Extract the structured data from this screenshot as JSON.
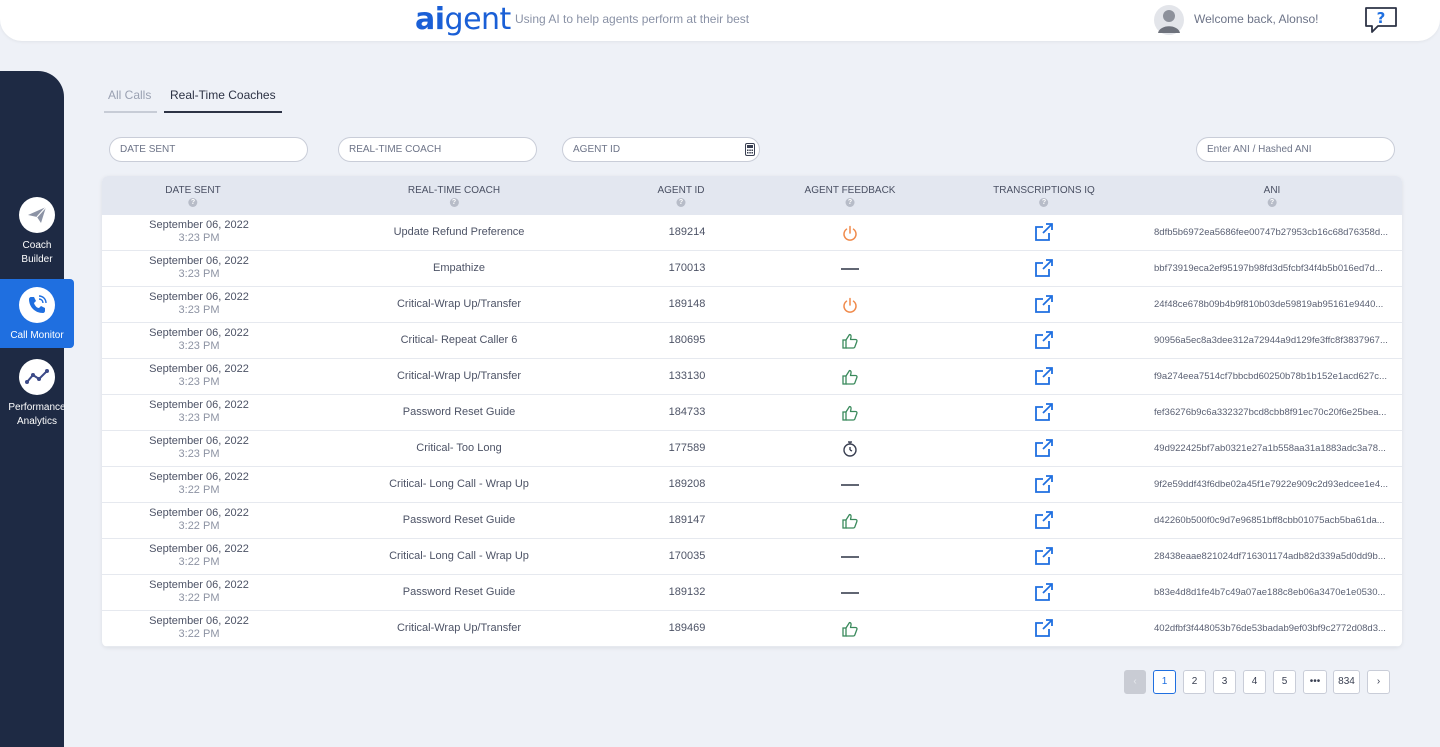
{
  "header": {
    "logo_ai": "ai",
    "logo_gent": "gent",
    "tagline": "Using AI to help agents perform at their best",
    "welcome": "Welcome back, Alonso!"
  },
  "sidebar": {
    "items": [
      {
        "label_line1": "Coach",
        "label_line2": "Builder",
        "icon": "paper-plane-icon"
      },
      {
        "label_line1": "Call Monitor",
        "label_line2": "",
        "icon": "phone-icon",
        "active": true
      },
      {
        "label_line1": "Performance",
        "label_line2": "Analytics",
        "icon": "line-chart-icon"
      }
    ]
  },
  "tabs": [
    {
      "label": "All Calls",
      "active": false
    },
    {
      "label": "Real-Time Coaches",
      "active": true
    }
  ],
  "filters": {
    "date_sent": "DATE SENT",
    "coach": "REAL-TIME COACH",
    "agent_id": "AGENT ID",
    "ani": "Enter ANI / Hashed ANI"
  },
  "table": {
    "columns": [
      "DATE SENT",
      "REAL-TIME COACH",
      "AGENT ID",
      "AGENT FEEDBACK",
      "TRANSCRIPTIONS IQ",
      "ANI"
    ],
    "rows": [
      {
        "date": "September 06, 2022",
        "time": "3:23 PM",
        "coach": "Update Refund Preference",
        "agent_id": "189214",
        "feedback": "power",
        "ani": "8dfb5b6972ea5686fee00747b27953cb16c68d76358d..."
      },
      {
        "date": "September 06, 2022",
        "time": "3:23 PM",
        "coach": "Empathize",
        "agent_id": "170013",
        "feedback": "dash",
        "ani": "bbf73919eca2ef95197b98fd3d5fcbf34f4b5b016ed7d..."
      },
      {
        "date": "September 06, 2022",
        "time": "3:23 PM",
        "coach": "Critical-Wrap Up/Transfer",
        "agent_id": "189148",
        "feedback": "power",
        "ani": "24f48ce678b09b4b9f810b03de59819ab95161e9440..."
      },
      {
        "date": "September 06, 2022",
        "time": "3:23 PM",
        "coach": "Critical- Repeat Caller 6",
        "agent_id": "180695",
        "feedback": "thumb",
        "ani": "90956a5ec8a3dee312a72944a9d129fe3ffc8f3837967..."
      },
      {
        "date": "September 06, 2022",
        "time": "3:23 PM",
        "coach": "Critical-Wrap Up/Transfer",
        "agent_id": "133130",
        "feedback": "thumb",
        "ani": "f9a274eea7514cf7bbcbd60250b78b1b152e1acd627c..."
      },
      {
        "date": "September 06, 2022",
        "time": "3:23 PM",
        "coach": "Password Reset Guide",
        "agent_id": "184733",
        "feedback": "thumb",
        "ani": "fef36276b9c6a332327bcd8cbb8f91ec70c20f6e25bea..."
      },
      {
        "date": "September 06, 2022",
        "time": "3:23 PM",
        "coach": "Critical- Too Long",
        "agent_id": "177589",
        "feedback": "timer",
        "ani": "49d922425bf7ab0321e27a1b558aa31a1883adc3a78..."
      },
      {
        "date": "September 06, 2022",
        "time": "3:22 PM",
        "coach": "Critical- Long Call - Wrap Up",
        "agent_id": "189208",
        "feedback": "dash",
        "ani": "9f2e59ddf43f6dbe02a45f1e7922e909c2d93edcee1e4..."
      },
      {
        "date": "September 06, 2022",
        "time": "3:22 PM",
        "coach": "Password Reset Guide",
        "agent_id": "189147",
        "feedback": "thumb",
        "ani": "d42260b500f0c9d7e96851bff8cbb01075acb5ba61da..."
      },
      {
        "date": "September 06, 2022",
        "time": "3:22 PM",
        "coach": "Critical- Long Call - Wrap Up",
        "agent_id": "170035",
        "feedback": "dash",
        "ani": "28438eaae821024df716301174adb82d339a5d0dd9b..."
      },
      {
        "date": "September 06, 2022",
        "time": "3:22 PM",
        "coach": "Password Reset Guide",
        "agent_id": "189132",
        "feedback": "dash",
        "ani": "b83e4d8d1fe4b7c49a07ae188c8eb06a3470e1e0530..."
      },
      {
        "date": "September 06, 2022",
        "time": "3:22 PM",
        "coach": "Critical-Wrap Up/Transfer",
        "agent_id": "189469",
        "feedback": "thumb",
        "ani": "402dfbf3f448053b76de53badab9ef03bf9c2772d08d3..."
      }
    ]
  },
  "pagination": {
    "prev": "‹",
    "pages": [
      "1",
      "2",
      "3",
      "4",
      "5"
    ],
    "ellipsis": "•••",
    "last": "834",
    "next": "›",
    "current": "1"
  },
  "colors": {
    "brand_blue": "#1a5fd6",
    "active_nav": "#1f6fe0",
    "sidebar_bg": "#1e2a44",
    "power_orange": "#f08a4b",
    "thumb_green": "#3a8a5c"
  }
}
